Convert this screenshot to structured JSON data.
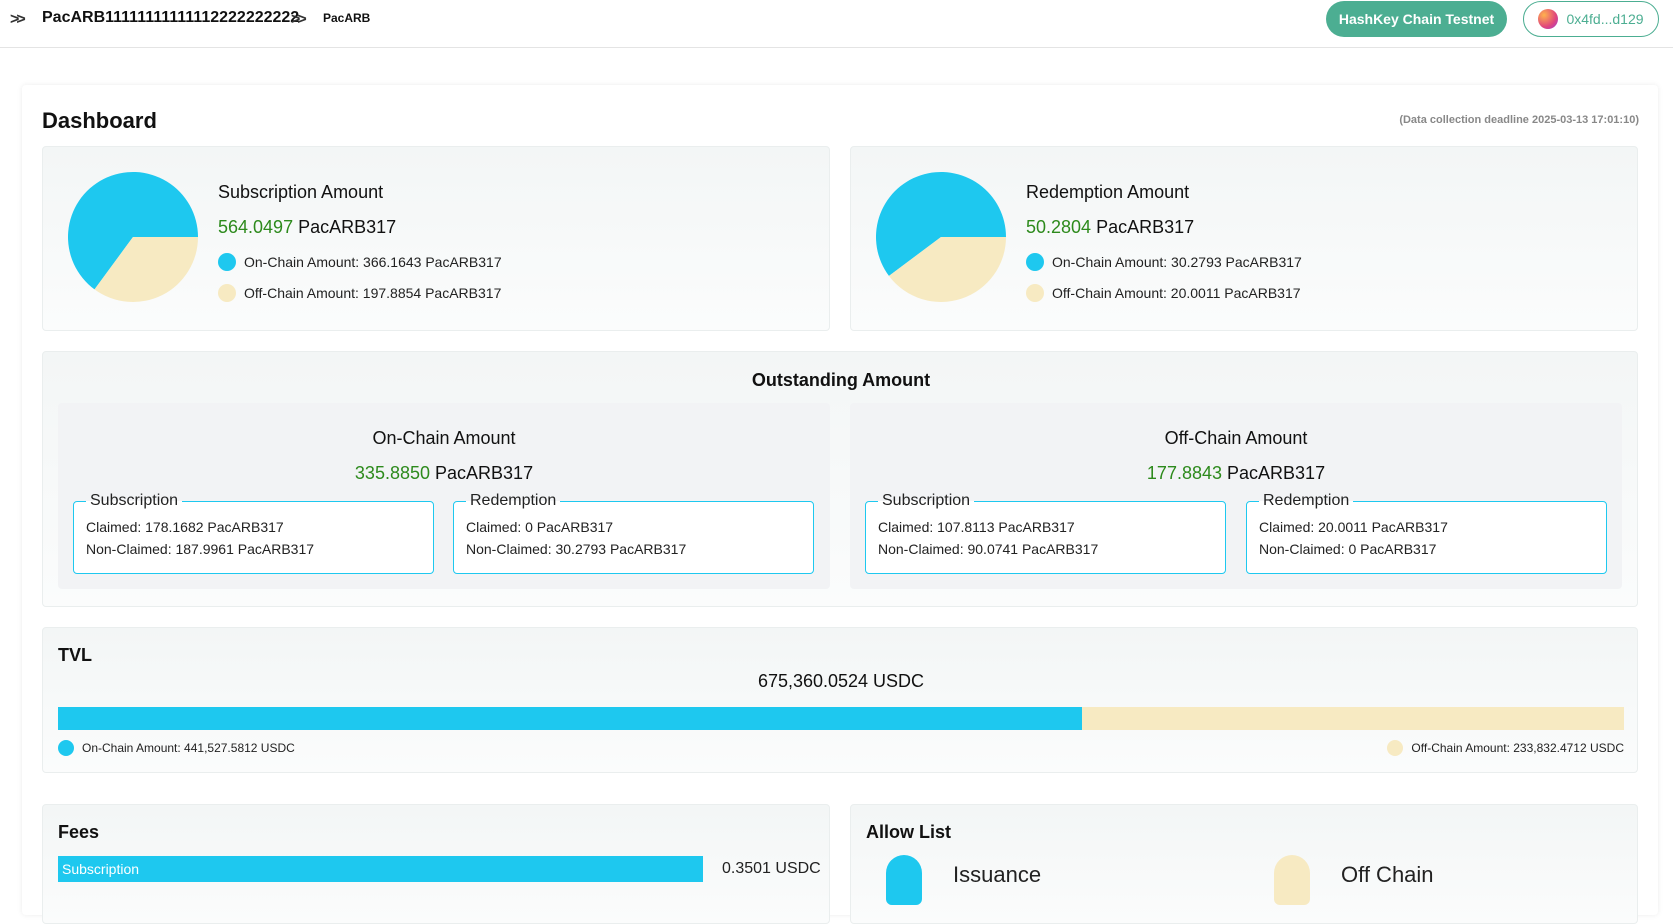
{
  "breadcrumb": {
    "item1": "PacARB11111111111112222222222",
    "item2": "PacARB"
  },
  "header": {
    "network_button": "HashKey Chain Testnet",
    "wallet_address": "0x4fd...d129"
  },
  "dashboard": {
    "title": "Dashboard",
    "deadline": "(Data collection deadline 2025-03-13 17:01:10)"
  },
  "subscription": {
    "title": "Subscription Amount",
    "total_value": "564.0497",
    "unit": "PacARB317",
    "on_chain_label": "On-Chain Amount: 366.1643 PacARB317",
    "off_chain_label": "Off-Chain Amount: 197.8854 PacARB317",
    "on_chain_value": 366.1643,
    "off_chain_value": 197.8854
  },
  "redemption": {
    "title": "Redemption Amount",
    "total_value": "50.2804",
    "unit": "PacARB317",
    "on_chain_label": "On-Chain Amount: 30.2793 PacARB317",
    "off_chain_label": "Off-Chain Amount: 20.0011 PacARB317",
    "on_chain_value": 30.2793,
    "off_chain_value": 20.0011
  },
  "outstanding": {
    "title": "Outstanding Amount",
    "on_chain": {
      "title": "On-Chain Amount",
      "value": "335.8850",
      "unit": "PacARB317",
      "subscription": {
        "legend": "Subscription",
        "claimed": "Claimed: 178.1682 PacARB317",
        "non_claimed": "Non-Claimed: 187.9961 PacARB317"
      },
      "redemption": {
        "legend": "Redemption",
        "claimed": "Claimed: 0 PacARB317",
        "non_claimed": "Non-Claimed: 30.2793 PacARB317"
      }
    },
    "off_chain": {
      "title": "Off-Chain Amount",
      "value": "177.8843",
      "unit": "PacARB317",
      "subscription": {
        "legend": "Subscription",
        "claimed": "Claimed: 107.8113 PacARB317",
        "non_claimed": "Non-Claimed: 90.0741 PacARB317"
      },
      "redemption": {
        "legend": "Redemption",
        "claimed": "Claimed: 20.0011 PacARB317",
        "non_claimed": "Non-Claimed: 0 PacARB317"
      }
    }
  },
  "tvl": {
    "title": "TVL",
    "total": "675,360.0524 USDC",
    "on_chain_label": "On-Chain Amount: 441,527.5812 USDC",
    "off_chain_label": "Off-Chain Amount: 233,832.4712 USDC",
    "on_chain_value": 441527.5812,
    "off_chain_value": 233832.4712
  },
  "fees": {
    "title": "Fees",
    "subscription_label": "Subscription",
    "subscription_value": "0.3501 USDC"
  },
  "allow_list": {
    "title": "Allow List",
    "issuance_label": "Issuance",
    "off_chain_label": "Off Chain"
  },
  "colors": {
    "on_chain": "#1ec8ef",
    "off_chain": "#f7eac2",
    "accent": "#4cae92",
    "value_green": "#2d8a1c"
  },
  "icons": [
    "double-chevron-right-icon",
    "wallet-avatar-icon",
    "user-icon"
  ]
}
